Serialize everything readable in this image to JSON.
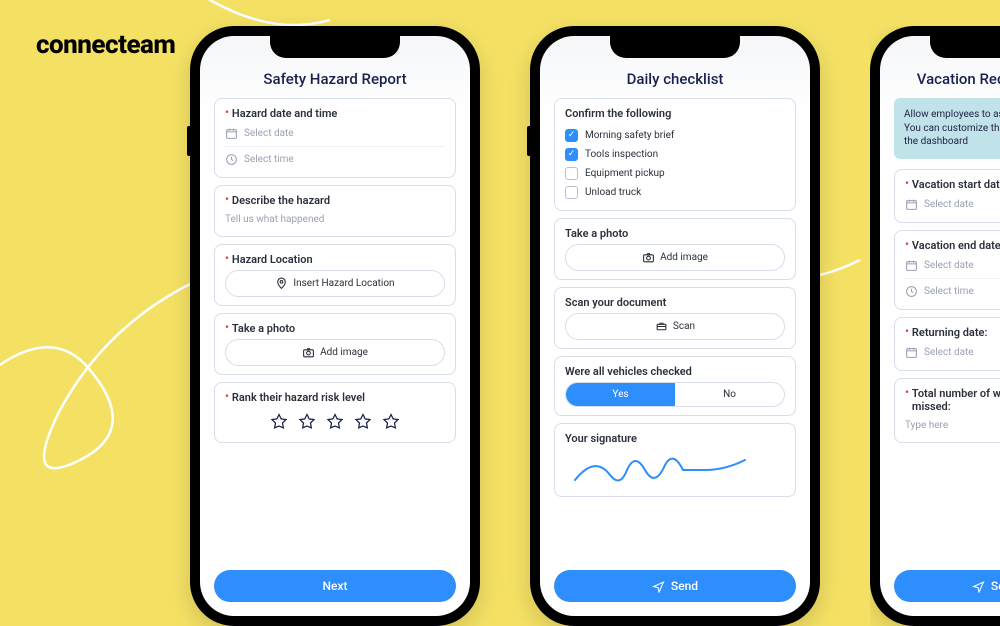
{
  "brand": "connecteam",
  "phone1": {
    "title": "Safety Hazard Report",
    "f1_label": "Hazard date and time",
    "f1_date_ph": "Select date",
    "f1_time_ph": "Select time",
    "f2_label": "Describe the hazard",
    "f2_ph": "Tell us what happened",
    "f3_label": "Hazard Location",
    "f3_ph": "Insert Hazard Location",
    "f4_label": "Take a photo",
    "f4_btn": "Add image",
    "f5_label": "Rank their hazard risk level",
    "submit": "Next"
  },
  "phone2": {
    "title": "Daily checklist",
    "confirm_label": "Confirm the following",
    "chk1": "Morning safety brief",
    "chk2": "Tools inspection",
    "chk3": "Equipment pickup",
    "chk4": "Unload truck",
    "photo_label": "Take a photo",
    "photo_btn": "Add image",
    "scan_label": "Scan your document",
    "scan_btn": "Scan",
    "vehicles_label": "Were all vehicles checked",
    "yes": "Yes",
    "no": "No",
    "sig_label": "Your signature",
    "submit": "Send"
  },
  "phone3": {
    "title": "Vacation Request Form",
    "info": "Allow employees to ask for a vacation. You can customize this template from the dashboard",
    "f1_label": "Vacation start date:",
    "f1_ph": "Select date",
    "f2_label": "Vacation end date:",
    "f2_date_ph": "Select date",
    "f2_time_ph": "Select time",
    "f3_label": "Returning date:",
    "f3_ph": "Select date",
    "f4_label": "Total number of working days missed:",
    "f4_ph": "Type here",
    "submit": "Send"
  }
}
